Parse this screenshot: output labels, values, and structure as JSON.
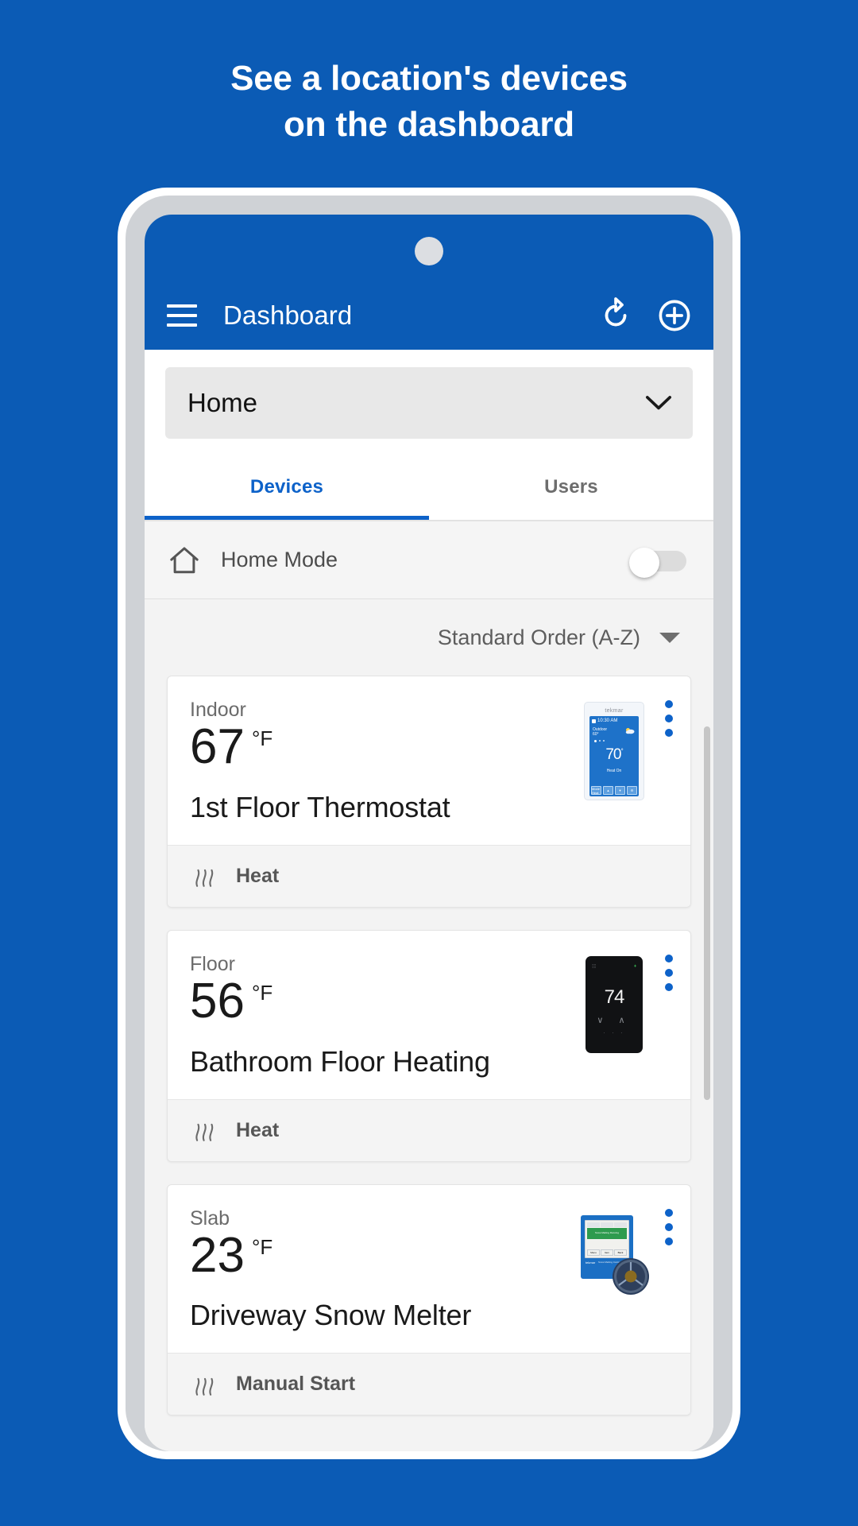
{
  "promo": {
    "headline_line1": "See a location's devices",
    "headline_line2": "on the dashboard",
    "background_color": "#0b5bb5"
  },
  "appbar": {
    "menu_icon": "hamburger-menu-icon",
    "title": "Dashboard",
    "refresh_icon": "refresh-icon",
    "add_icon": "add-circle-icon",
    "background_color": "#0b5bb5",
    "text_color": "#ffffff"
  },
  "location_selector": {
    "selected": "Home",
    "dropdown_icon": "chevron-down-icon"
  },
  "tabs": {
    "items": [
      {
        "label": "Devices",
        "active": true
      },
      {
        "label": "Users",
        "active": false
      }
    ],
    "active_color": "#0d62c9",
    "inactive_color": "#6d6d6d"
  },
  "home_mode": {
    "icon": "home-outline-icon",
    "label": "Home Mode",
    "toggle_state": "off"
  },
  "sort": {
    "label": "Standard Order (A-Z)",
    "caret_icon": "caret-down-icon"
  },
  "devices": [
    {
      "kind": "Indoor",
      "temperature": "67",
      "unit": "°F",
      "name": "1st Floor Thermostat",
      "status": "Heat",
      "status_icon": "heat-waves-icon",
      "menu_icon": "kebab-menu-icon",
      "thumbnail": "tekmar-touchscreen-thermostat-icon",
      "thumb_detail": {
        "brand": "tekmar",
        "time": "10:30 AM",
        "outdoor_label": "Outdoor",
        "outdoor_temp": "60°",
        "setpoint": "70",
        "setpoint_degree": "°",
        "mode_text": "Heat On",
        "buttons": [
          "Mode Heat",
          "▲",
          "▼",
          "⚙"
        ]
      }
    },
    {
      "kind": "Floor",
      "temperature": "56",
      "unit": "°F",
      "name": "Bathroom Floor Heating",
      "status": "Heat",
      "status_icon": "heat-waves-icon",
      "menu_icon": "kebab-menu-icon",
      "thumbnail": "black-thermostat-icon",
      "thumb_detail": {
        "setpoint": "74",
        "arrows": "∨  ∧",
        "dots": "· · ·"
      }
    },
    {
      "kind": "Slab",
      "temperature": "23",
      "unit": "°F",
      "name": "Driveway Snow Melter",
      "status": "Manual Start",
      "status_icon": "heat-waves-icon",
      "menu_icon": "kebab-menu-icon",
      "thumbnail": "snow-melting-control-icon",
      "thumb_detail": {
        "brand": "tekmar",
        "model": "Snow Melting Control",
        "screen_status": "Snow Melting Running",
        "keys": [
          "Menu",
          "Item",
          "Back"
        ]
      }
    }
  ],
  "scrollbar": {
    "visible": true
  }
}
